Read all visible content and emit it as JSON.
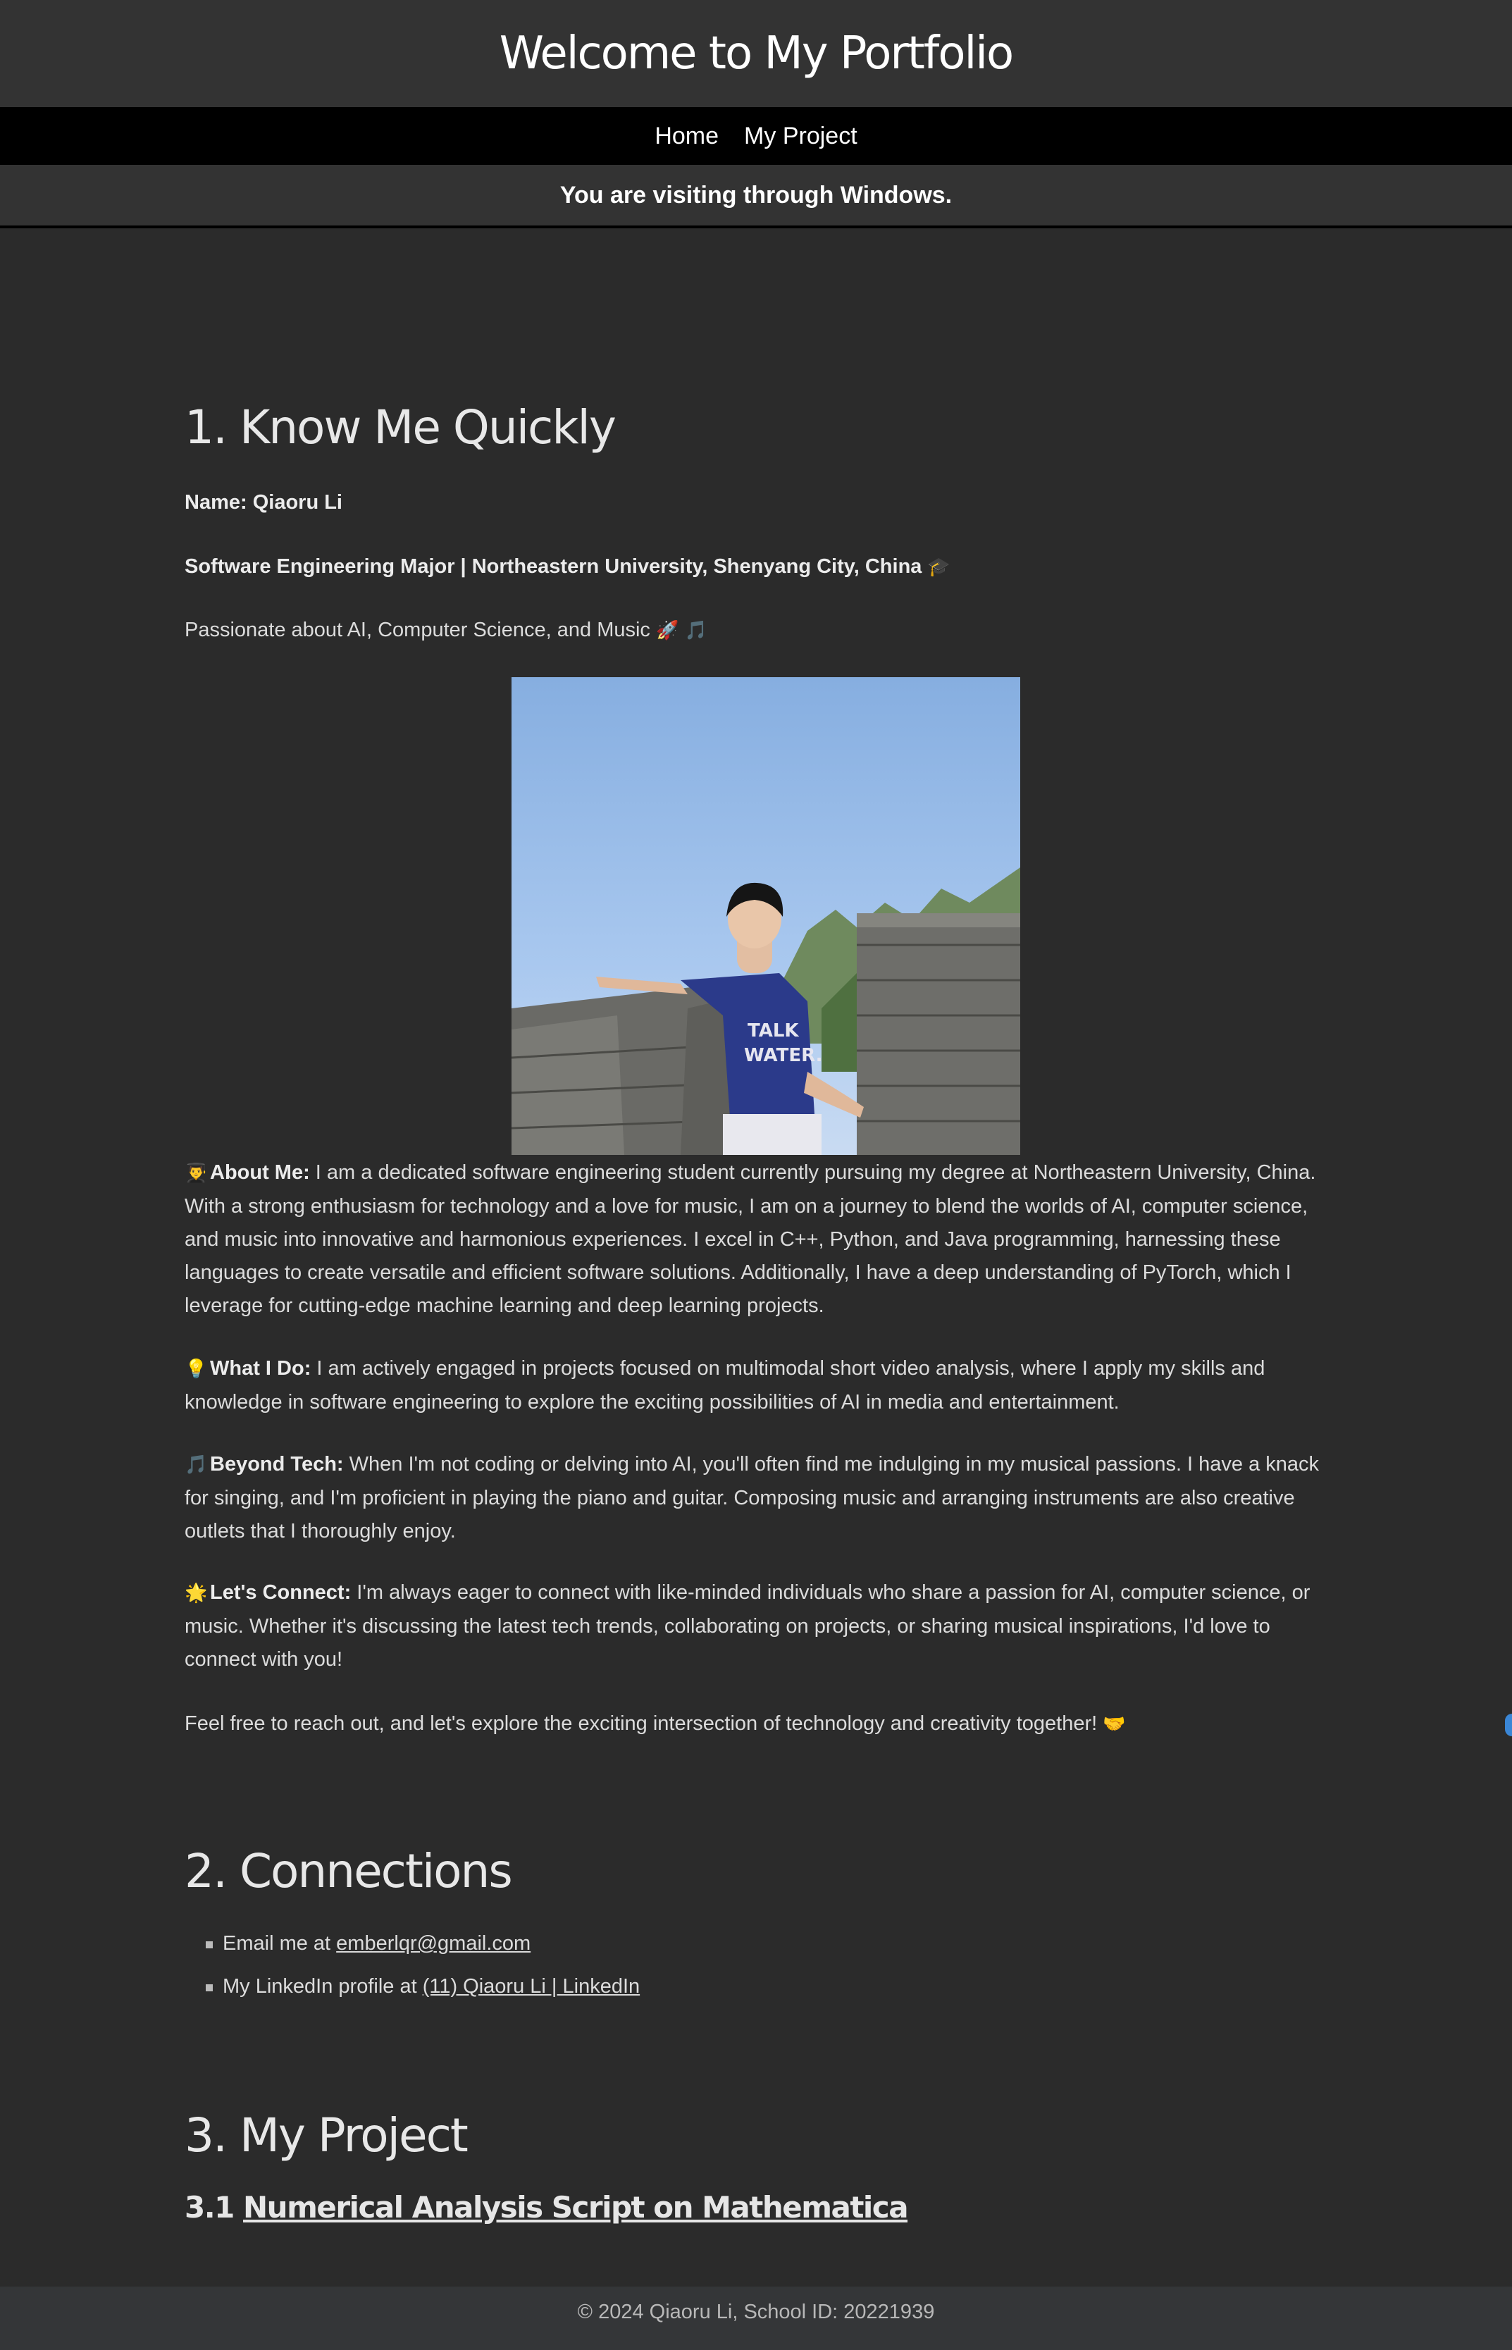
{
  "header": {
    "title": "Welcome to My Portfolio"
  },
  "nav": {
    "items": [
      {
        "label": "Home"
      },
      {
        "label": "My Project"
      }
    ]
  },
  "visit_banner": {
    "text": "You are visiting through Windows."
  },
  "know_me": {
    "heading": "1. Know Me Quickly",
    "name_line": "Name: Qiaoru Li",
    "major_line": "Software Engineering Major | Northeastern University, Shenyang City, China",
    "major_emoji": "🎓",
    "passion_line": "Passionate about AI, Computer Science, and Music",
    "passion_emoji": "🚀 🎵",
    "photo_icon": "profile-photo",
    "about": {
      "emoji": "👨‍🎓",
      "label": "About Me:",
      "text": " I am a dedicated software engineering student currently pursuing my degree at Northeastern University, China. With a strong enthusiasm for technology and a love for music, I am on a journey to blend the worlds of AI, computer science, and music into innovative and harmonious experiences. I excel in C++, Python, and Java programming, harnessing these languages to create versatile and efficient software solutions. Additionally, I have a deep understanding of PyTorch, which I leverage for cutting-edge machine learning and deep learning projects."
    },
    "what_i_do": {
      "emoji": "💡",
      "label": "What I Do:",
      "text": " I am actively engaged in projects focused on multimodal short video analysis, where I apply my skills and knowledge in software engineering to explore the exciting possibilities of AI in media and entertainment."
    },
    "beyond_tech": {
      "emoji": "🎵",
      "label": "Beyond Tech:",
      "text": " When I'm not coding or delving into AI, you'll often find me indulging in my musical passions. I have a knack for singing, and I'm proficient in playing the piano and guitar. Composing music and arranging instruments are also creative outlets that I thoroughly enjoy."
    },
    "lets_connect": {
      "emoji": "🌟",
      "label": "Let's Connect:",
      "text": " I'm always eager to connect with like-minded individuals who share a passion for AI, computer science, or music. Whether it's discussing the latest tech trends, collaborating on projects, or sharing musical inspirations, I'd love to connect with you!"
    },
    "closing": "Feel free to reach out, and let's explore the exciting intersection of technology and creativity together!",
    "closing_emoji": "🤝"
  },
  "connections": {
    "heading": "2. Connections",
    "email_prefix": "Email me at ",
    "email_link": "emberlqr@gmail.com",
    "linkedin_prefix": "My LinkedIn profile at ",
    "linkedin_link": "(11) Qiaoru Li | LinkedIn"
  },
  "projects": {
    "heading": "3. My Project",
    "item_number": "3.1 ",
    "item_title": "Numerical Analysis Script on Mathematica"
  },
  "footer": {
    "text": "© 2024 Qiaoru Li, School ID: 20221939"
  },
  "colors": {
    "background": "#2b2b2b",
    "header": "#333333",
    "nav": "#000000",
    "footer": "#343638",
    "text": "#dcdcdc"
  }
}
